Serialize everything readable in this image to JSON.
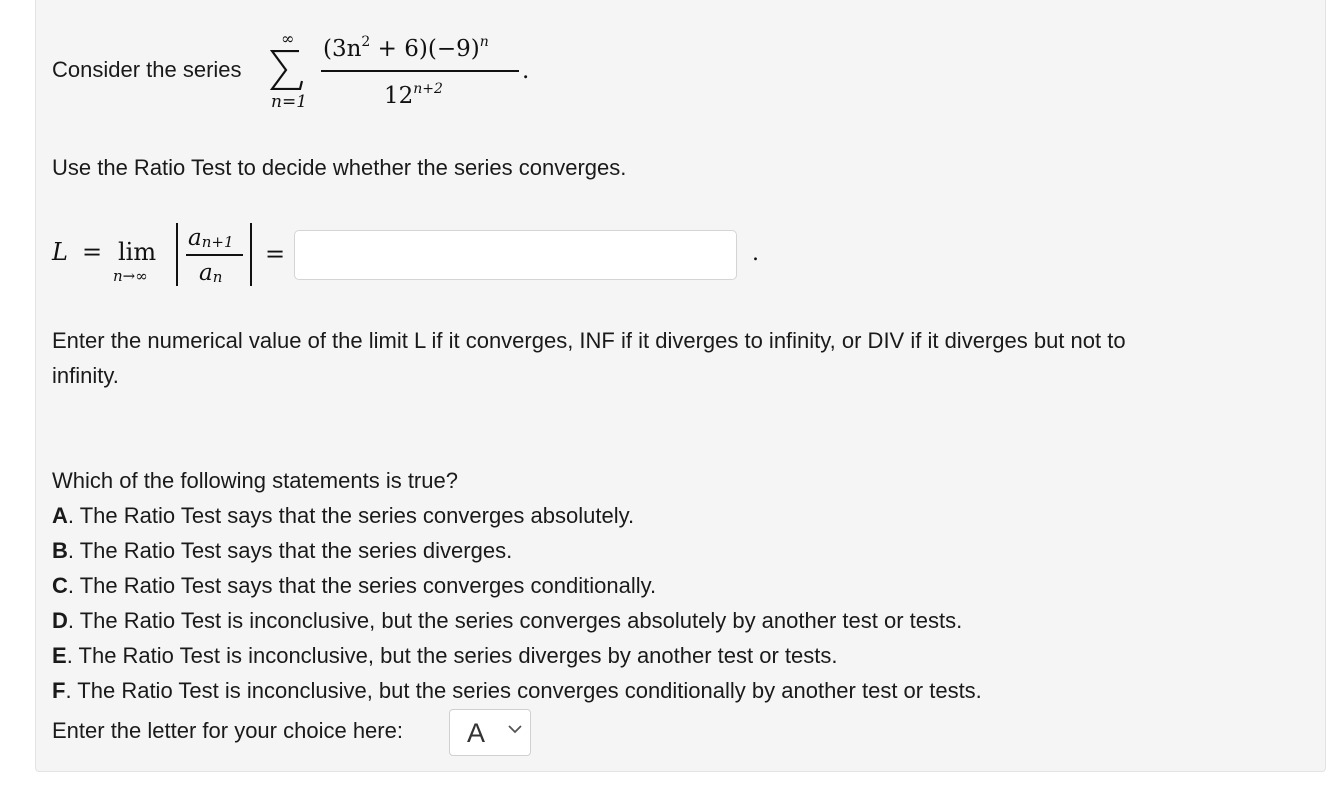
{
  "intro": {
    "prefix": "Consider the series",
    "sum_upper": "∞",
    "sum_lower": "n=1",
    "numerator_base": "(3n",
    "numerator_sq": "2",
    "numerator_rest": " + 6)(−9)",
    "numerator_exp": "n",
    "denominator_base": "12",
    "denominator_exp": "n+2",
    "end_period": "."
  },
  "instruction": "Use the Ratio Test to decide whether the series converges.",
  "limit": {
    "L": "L",
    "equals": "=",
    "lim": "lim",
    "lim_sub": "n→∞",
    "numer_a": "a",
    "numer_sub": "n+1",
    "denom_a": "a",
    "denom_sub": "n",
    "equals2": "=",
    "answer_value": "",
    "end_period": "."
  },
  "limit_help_line1": "Enter the numerical value of the limit L if it converges, INF if it diverges to infinity, or DIV if it diverges but not to",
  "limit_help_line2": "infinity.",
  "question": "Which of the following statements is true?",
  "options": [
    {
      "letter": "A",
      "sep": ".",
      "text": " The Ratio Test says that the series converges absolutely."
    },
    {
      "letter": "B",
      "sep": ".",
      "text": " The Ratio Test says that the series diverges."
    },
    {
      "letter": "C",
      "sep": ".",
      "text": " The Ratio Test says that the series converges conditionally."
    },
    {
      "letter": "D",
      "sep": ".",
      "text": " The Ratio Test is inconclusive, but the series converges absolutely by another test or tests."
    },
    {
      "letter": "E",
      "sep": ".",
      "text": " The Ratio Test is inconclusive, but the series diverges by another test or tests."
    },
    {
      "letter": "F",
      "sep": ".",
      "text": " The Ratio Test is inconclusive, but the series converges conditionally by another test or tests."
    }
  ],
  "choice": {
    "label": "Enter the letter for your choice here:",
    "selected": "A",
    "icon": "chevron-down-icon"
  }
}
